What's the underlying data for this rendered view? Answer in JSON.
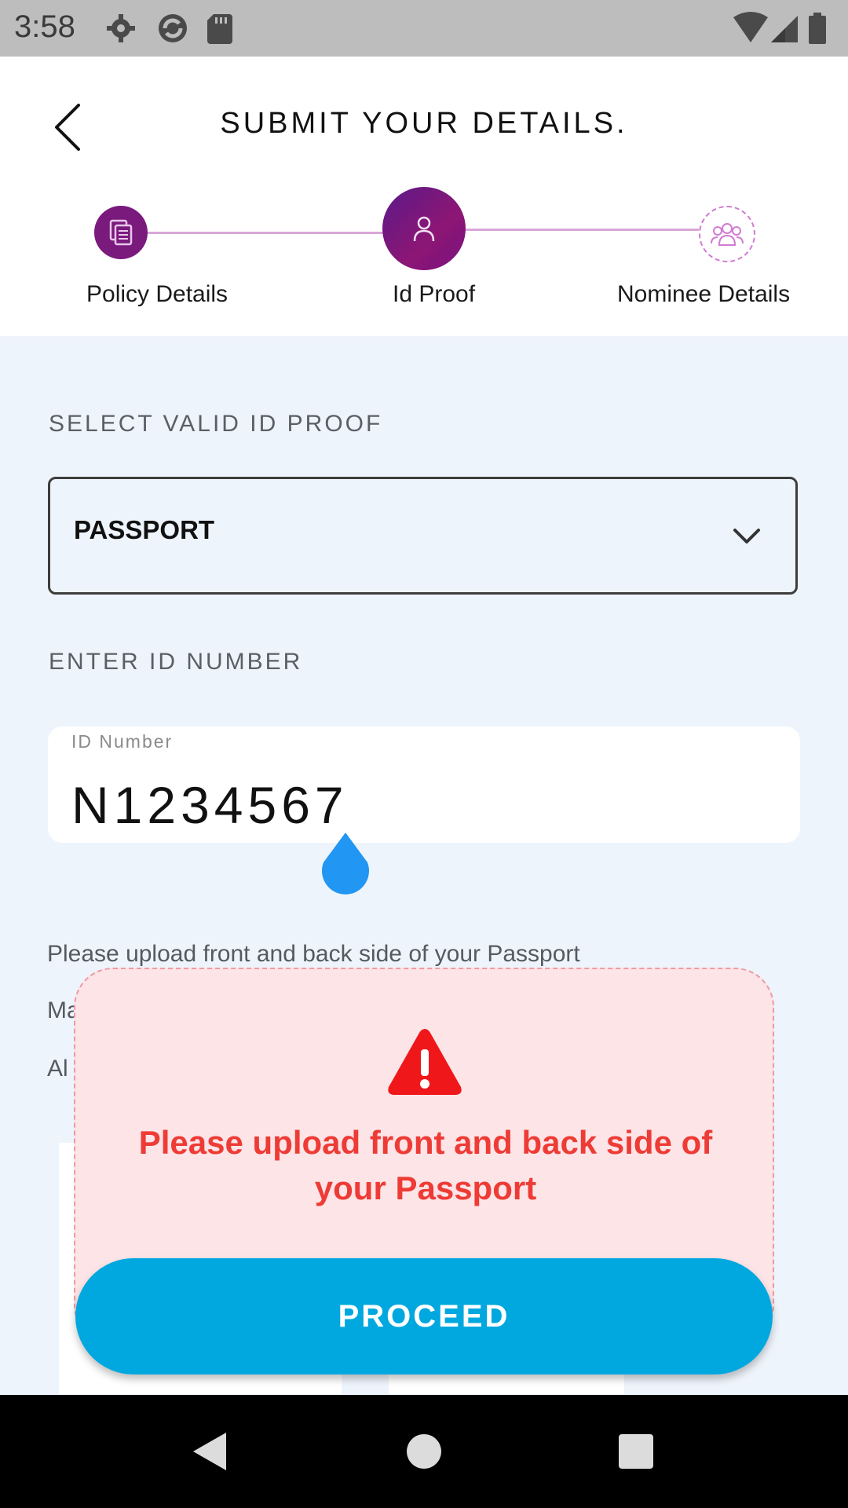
{
  "status_bar": {
    "time": "3:58",
    "left_icons": [
      "gear-icon",
      "sync-icon",
      "sd-card-icon"
    ],
    "right_icons": [
      "wifi-icon",
      "signal-icon",
      "battery-icon"
    ]
  },
  "header": {
    "title": "SUBMIT YOUR DETAILS.",
    "back_icon": "chevron-left-icon"
  },
  "stepper": {
    "steps": [
      {
        "label": "Policy Details",
        "icon": "document-icon",
        "state": "completed"
      },
      {
        "label": "Id Proof",
        "icon": "person-icon",
        "state": "active"
      },
      {
        "label": "Nominee Details",
        "icon": "group-icon",
        "state": "pending"
      }
    ]
  },
  "form": {
    "id_proof_label": "SELECT VALID ID PROOF",
    "id_proof_selected": "PASSPORT",
    "id_number_section_label": "ENTER ID NUMBER",
    "id_number_field_label": "ID Number",
    "id_number_value": "N1234567"
  },
  "info": {
    "upload_instruction": "Please upload front and back side of your  Passport",
    "line2_partial": "Ma",
    "line3_partial": "Al"
  },
  "alert": {
    "icon": "warning-triangle-icon",
    "message": "Please upload front and back side of your Passport",
    "button_label": "PROCEED"
  },
  "colors": {
    "primary_purple": "#7a1a7d",
    "accent_blue": "#00a8df",
    "alert_red": "#ee3b35",
    "alert_bg": "#fce4e7",
    "page_bg": "#eef4fb"
  },
  "nav_bar": {
    "icons": [
      "nav-back-icon",
      "nav-home-icon",
      "nav-recents-icon"
    ]
  }
}
